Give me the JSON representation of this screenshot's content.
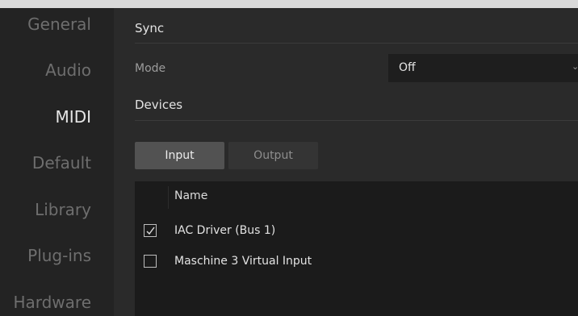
{
  "sidebar": {
    "items": [
      {
        "label": "General"
      },
      {
        "label": "Audio"
      },
      {
        "label": "MIDI",
        "active": true
      },
      {
        "label": "Default"
      },
      {
        "label": "Library"
      },
      {
        "label": "Plug-ins"
      },
      {
        "label": "Hardware"
      }
    ]
  },
  "sync": {
    "title": "Sync",
    "mode_label": "Mode",
    "mode_value": "Off",
    "chevron_icon": "chevron-down-icon"
  },
  "devices": {
    "title": "Devices",
    "tabs": [
      {
        "label": "Input",
        "selected": true
      },
      {
        "label": "Output",
        "selected": false
      }
    ],
    "column_name": "Name",
    "rows": [
      {
        "name": "IAC Driver (Bus 1)",
        "checked": true
      },
      {
        "name": "Maschine 3 Virtual Input",
        "checked": false
      }
    ]
  },
  "colors": {
    "background": "#262626",
    "active_text": "#e6e6e6",
    "inactive_text": "#6e6e6e"
  }
}
